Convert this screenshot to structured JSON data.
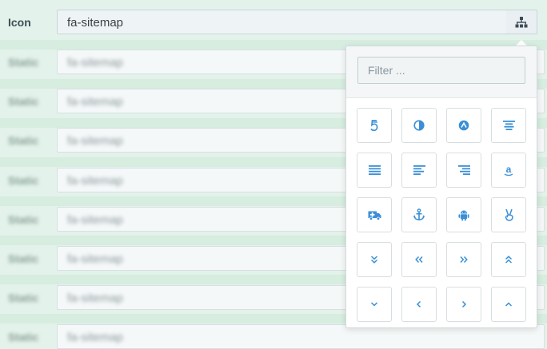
{
  "main_row": {
    "label": "Icon",
    "value": "fa-sitemap",
    "addon_icon": "sitemap-icon"
  },
  "blurred_rows": [
    {
      "label": "Static",
      "value": "fa-sitemap"
    },
    {
      "label": "Static",
      "value": "fa-sitemap"
    },
    {
      "label": "Static",
      "value": "fa-sitemap"
    },
    {
      "label": "Static",
      "value": "fa-sitemap"
    },
    {
      "label": "Static",
      "value": "fa-sitemap"
    },
    {
      "label": "Static",
      "value": "fa-sitemap"
    },
    {
      "label": "Static",
      "value": "fa-sitemap"
    },
    {
      "label": "Static",
      "value": "fa-sitemap"
    }
  ],
  "picker": {
    "filter_placeholder": "Filter ...",
    "icons": [
      "500px-icon",
      "adjust-icon",
      "adn-icon",
      "align-center-icon",
      "align-justify-icon",
      "align-left-icon",
      "align-right-icon",
      "amazon-icon",
      "ambulance-icon",
      "anchor-icon",
      "android-icon",
      "angellist-icon",
      "angle-double-down-icon",
      "angle-double-left-icon",
      "angle-double-right-icon",
      "angle-double-up-icon",
      "angle-down-icon",
      "angle-left-icon",
      "angle-right-icon",
      "angle-up-icon"
    ]
  },
  "colors": {
    "icon_blue": "#3a8fd6",
    "background": "#e3f2ea"
  }
}
